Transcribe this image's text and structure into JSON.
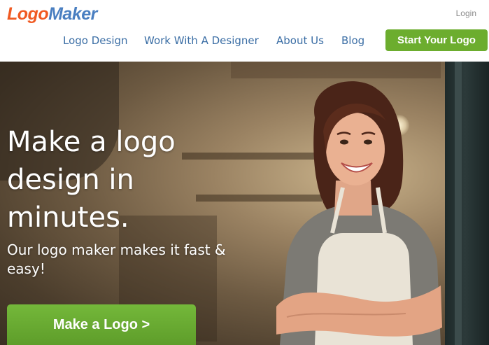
{
  "header": {
    "logo": {
      "part1": "Logo",
      "part2": "Maker"
    },
    "login": "Login",
    "nav": [
      {
        "label": "Logo Design"
      },
      {
        "label": "Work With A Designer"
      },
      {
        "label": "About Us"
      },
      {
        "label": "Blog"
      }
    ],
    "cta": "Start Your Logo"
  },
  "hero": {
    "headline": "Make a logo design in minutes.",
    "subheadline": "Our logo maker makes it fast & easy!",
    "button": "Make a Logo >"
  },
  "colors": {
    "brand_orange": "#f05a22",
    "brand_blue": "#4a7fc1",
    "nav_blue": "#3b6ea5",
    "accent_green": "#6cad2e"
  }
}
